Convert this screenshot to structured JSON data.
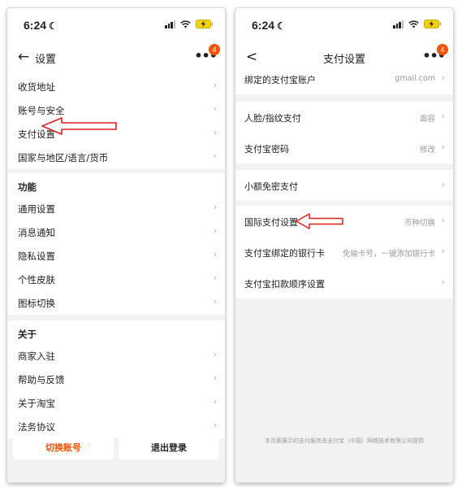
{
  "left": {
    "status": {
      "time": "6:24",
      "badge": "4"
    },
    "nav": {
      "back": "←",
      "title": "设置",
      "more": "•••"
    },
    "group1": [
      {
        "label": "收货地址"
      },
      {
        "label": "账号与安全"
      },
      {
        "label": "支付设置"
      },
      {
        "label": "国家与地区/语言/货币"
      }
    ],
    "group2": {
      "header": "功能",
      "items": [
        {
          "label": "通用设置"
        },
        {
          "label": "消息通知"
        },
        {
          "label": "隐私设置"
        },
        {
          "label": "个性皮肤"
        },
        {
          "label": "图标切换"
        }
      ]
    },
    "group3": {
      "header": "关于",
      "items": [
        {
          "label": "商家入驻"
        },
        {
          "label": "帮助与反馈"
        },
        {
          "label": "关于淘宝"
        },
        {
          "label": "法务协议"
        }
      ]
    },
    "buttons": {
      "switch": "切换账号",
      "logout": "退出登录"
    },
    "colors": {
      "switch_text": "#ff5000",
      "logout_text": "#222222",
      "arrow": "#e02020"
    }
  },
  "right": {
    "status": {
      "time": "6:24",
      "badge": "4"
    },
    "nav": {
      "back": "<",
      "title": "支付设置",
      "more": "•••"
    },
    "rows": [
      {
        "label": "绑定的支付宝账户",
        "value": "gmail.com"
      },
      {
        "label": "人脸/指纹支付",
        "value": "面容"
      },
      {
        "label": "支付宝密码",
        "value": "修改"
      },
      {
        "label": "小额免密支付",
        "value": ""
      },
      {
        "label": "国际支付设置",
        "value": "币种切换"
      },
      {
        "label": "支付宝绑定的银行卡",
        "value": "免输卡号，一键添加银行卡"
      },
      {
        "label": "支付宝扣款顺序设置",
        "value": ""
      }
    ],
    "footer": "本页面展示的支付服务由支付宝（中国）网络技术有限公司提供"
  },
  "icons": {
    "chevron": "›",
    "moon": "☾"
  }
}
